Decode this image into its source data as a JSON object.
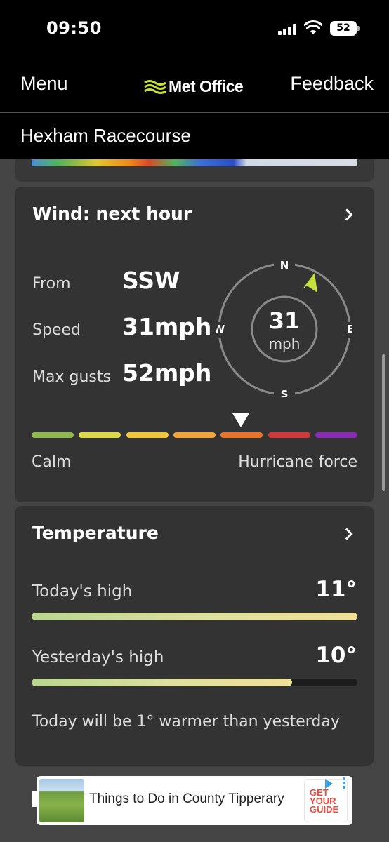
{
  "status_bar": {
    "time": "09:50",
    "battery": "52"
  },
  "nav": {
    "menu_label": "Menu",
    "logo_text": "Met Office",
    "feedback_label": "Feedback"
  },
  "location": {
    "name": "Hexham Racecourse"
  },
  "wind": {
    "title": "Wind: next hour",
    "from_label": "From",
    "from_value": "SSW",
    "speed_label": "Speed",
    "speed_value": "31mph",
    "gusts_label": "Max gusts",
    "gusts_value": "52mph",
    "compass": {
      "n": "N",
      "e": "E",
      "s": "S",
      "w": "W",
      "speed_number": "31",
      "speed_unit": "mph"
    },
    "scale_colors": [
      "#8fb84e",
      "#dcd84a",
      "#f0c53a",
      "#f0a43a",
      "#e8742c",
      "#d13a3a",
      "#8a2bb3"
    ],
    "scale_position_segment": 4,
    "calm_label": "Calm",
    "hurricane_label": "Hurricane force"
  },
  "temperature": {
    "title": "Temperature",
    "today_label": "Today's high",
    "today_value": "11°",
    "today_fill": 1.0,
    "yesterday_label": "Yesterday's high",
    "yesterday_value": "10°",
    "yesterday_fill": 0.8,
    "summary": "Today will be 1° warmer than yesterday"
  },
  "ad": {
    "text": "Things to Do in County Tipperary",
    "logo_text": "GET YOUR GUIDE"
  },
  "colors": {
    "accent_green": "#c5e23c",
    "card_bg": "#333333",
    "page_bg": "#454545"
  }
}
